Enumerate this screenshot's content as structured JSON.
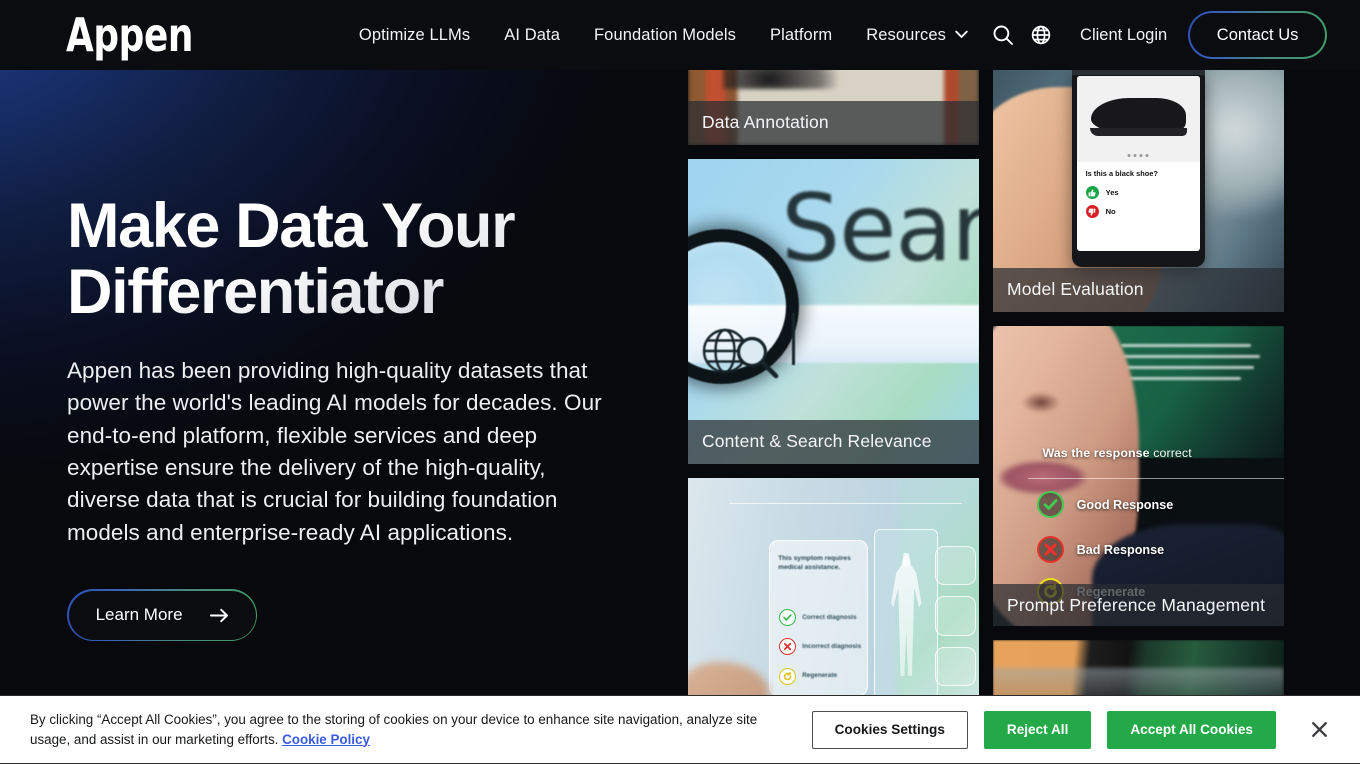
{
  "header": {
    "logo_text": "Appen",
    "nav": [
      {
        "label": "Optimize LLMs",
        "has_dropdown": false
      },
      {
        "label": "AI Data",
        "has_dropdown": false
      },
      {
        "label": "Foundation Models",
        "has_dropdown": false
      },
      {
        "label": "Platform",
        "has_dropdown": false
      },
      {
        "label": "Resources",
        "has_dropdown": true
      }
    ],
    "search_icon": "search-icon",
    "globe_icon": "globe-icon",
    "client_login_label": "Client Login",
    "contact_label": "Contact Us"
  },
  "hero": {
    "title": "Make Data Your Differentiator",
    "body": "Appen has been providing high-quality datasets that power the world's leading AI models for decades. Our end-to-end platform, flexible services and deep expertise ensure the delivery of the high-quality, diverse data that is crucial for building foundation models and enterprise-ready AI applications.",
    "cta_label": "Learn More",
    "cta_icon": "arrow-right-icon"
  },
  "cards": {
    "data_annotation": {
      "label": "Data Annotation"
    },
    "content_search": {
      "label": "Content & Search Relevance",
      "art_text": "Sear"
    },
    "medical": {
      "prompt": "This symptom requires medical assistance.",
      "options": [
        {
          "label": "Correct diagnosis",
          "state": "good"
        },
        {
          "label": "Incorrect diagnosis",
          "state": "bad"
        },
        {
          "label": "Regenerate",
          "state": "regen"
        }
      ]
    },
    "model_evaluation": {
      "label": "Model Evaluation",
      "question": "Is this a black shoe?",
      "answers": [
        {
          "label": "Yes",
          "state": "up"
        },
        {
          "label": "No",
          "state": "down"
        }
      ]
    },
    "prompt_preference": {
      "label": "Prompt Preference Management",
      "question_bold": "Was the response",
      "question_rest": " correct",
      "options": [
        {
          "label": "Good Response",
          "state": "good"
        },
        {
          "label": "Bad Response",
          "state": "bad"
        },
        {
          "label": "Regenerate",
          "state": "regen"
        }
      ]
    },
    "laptop": {
      "label": ""
    }
  },
  "cookie_banner": {
    "text_part1": "By clicking “Accept All Cookies”, you agree to the storing of cookies on your device to enhance site navigation, analyze site usage, and assist in our marketing efforts.",
    "policy_link": "Cookie Policy",
    "settings_label": "Cookies Settings",
    "reject_label": "Reject All",
    "accept_label": "Accept All Cookies",
    "close_icon": "close-icon"
  },
  "colors": {
    "header_bg": "#0b0c10",
    "page_bg": "#07090d",
    "blue_glow": "#1d3f8f",
    "green_glow": "#2f6f5c",
    "cookie_green": "#24a948",
    "cookie_link": "#3b5ae0",
    "gradient_border_from": "#2f4fb5",
    "gradient_border_to": "#3f9e67"
  }
}
